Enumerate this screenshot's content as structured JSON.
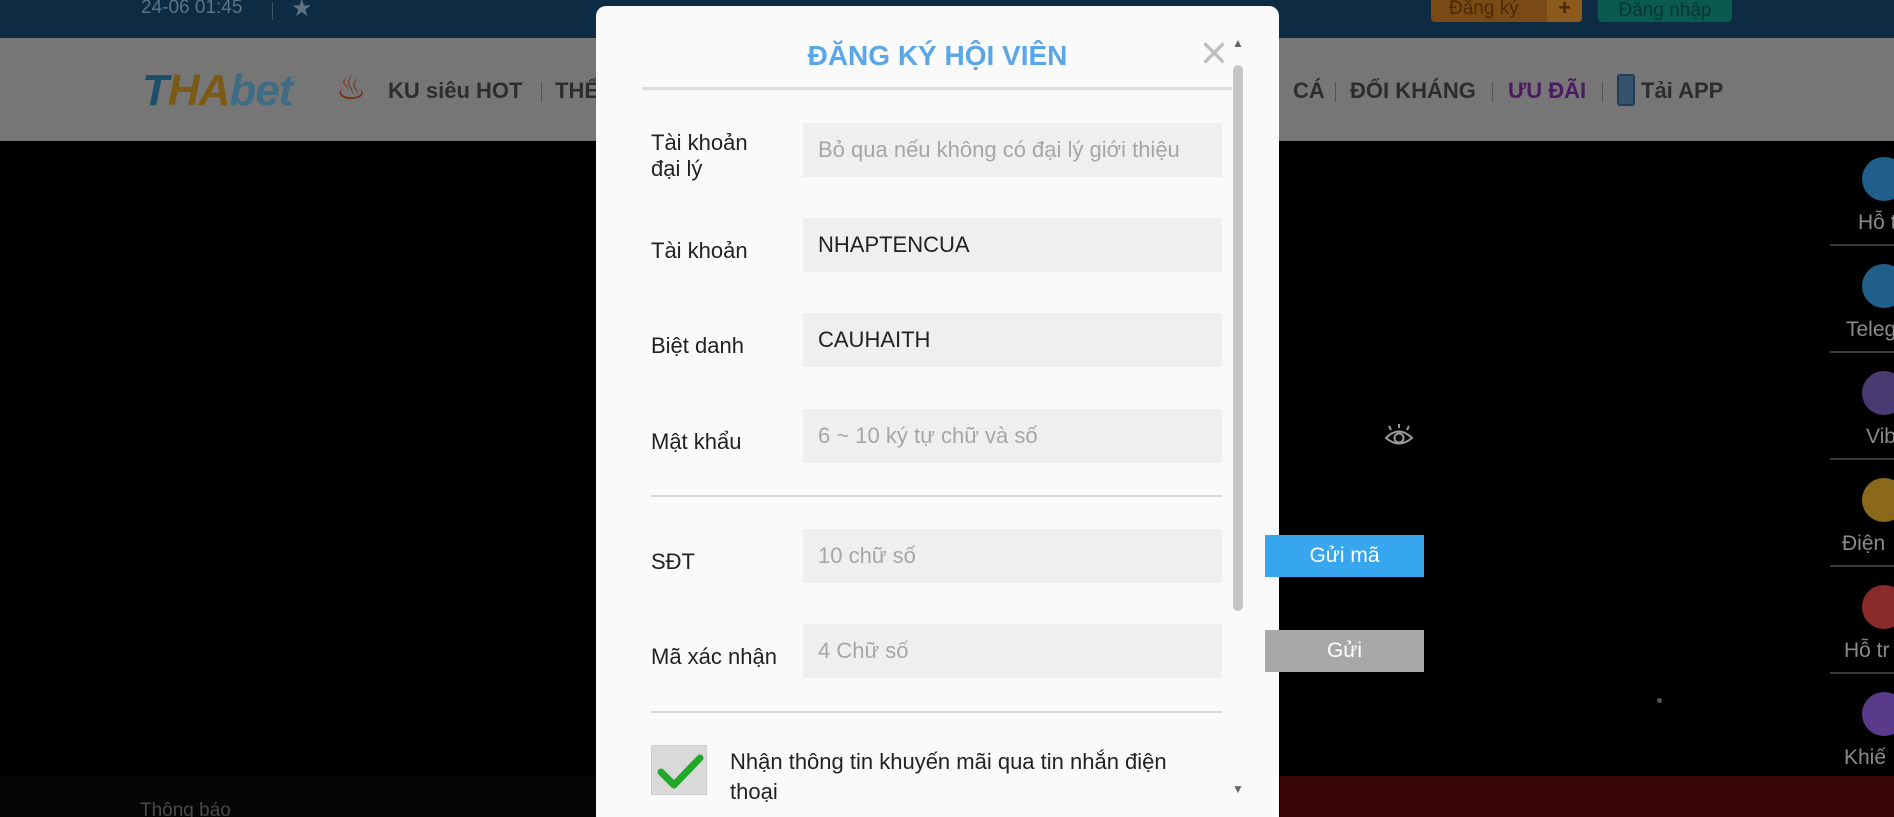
{
  "topbar": {
    "datetime": "24-06 01:45",
    "register_label": "Đăng ký",
    "login_label": "Đăng nhập"
  },
  "nav": {
    "logo": {
      "part1": "T",
      "part2": "HA",
      "part3": "bet"
    },
    "items": [
      {
        "label": "KU siêu HOT"
      },
      {
        "label": "THỂ"
      },
      {
        "label": "CÁ"
      },
      {
        "label": "ĐỐI KHÁNG"
      },
      {
        "label": "ƯU ĐÃI"
      },
      {
        "label": "Tải APP"
      }
    ]
  },
  "sidebar": {
    "items": [
      {
        "label": "Hỗ t",
        "icon": "headset-icon",
        "color": "#1f5f8a"
      },
      {
        "label": "Teleg",
        "icon": "telegram-icon",
        "color": "#1f5f8a"
      },
      {
        "label": "Vib",
        "icon": "viber-icon",
        "color": "#4a3a72"
      },
      {
        "label": "Điện",
        "icon": "phone-call-icon",
        "color": "#8a6a1a"
      },
      {
        "label": "Hỗ tr",
        "icon": "transfer-icon",
        "color": "#8a2a2a"
      },
      {
        "label": "Khiế",
        "icon": "complaint-icon",
        "color": "#5a3a8a"
      }
    ]
  },
  "footer": {
    "notice_label": "Thông báo"
  },
  "modal": {
    "title": "ĐĂNG KÝ HỘI VIÊN",
    "fields": {
      "agent": {
        "label_line1": "Tài khoản",
        "label_line2": "đại lý",
        "value": "",
        "placeholder": "Bỏ qua nếu không có đại lý giới thiệu"
      },
      "account": {
        "label": "Tài khoản",
        "value": "NHAPTENCUA",
        "placeholder": ""
      },
      "nickname": {
        "label": "Biệt danh",
        "value": "CAUHAITH",
        "placeholder": ""
      },
      "password": {
        "label": "Mật khẩu",
        "value": "",
        "placeholder": "6 ~ 10 ký tự chữ và số"
      },
      "phone": {
        "label": "SĐT",
        "value": "",
        "placeholder": "10 chữ số",
        "button_label": "Gửi mã"
      },
      "code": {
        "label": "Mã xác nhận",
        "value": "",
        "placeholder": "4 Chữ số",
        "button_label": "Gửi"
      }
    },
    "promo_checkbox": {
      "checked": true,
      "label": "Nhận thông tin khuyến mãi qua tin nhắn điện thoại"
    }
  },
  "colors": {
    "title": "#5aa6e6",
    "send_button_active": "#36a6ee",
    "send_button_disabled": "#a8a8a8",
    "check": "#1fa82a"
  }
}
